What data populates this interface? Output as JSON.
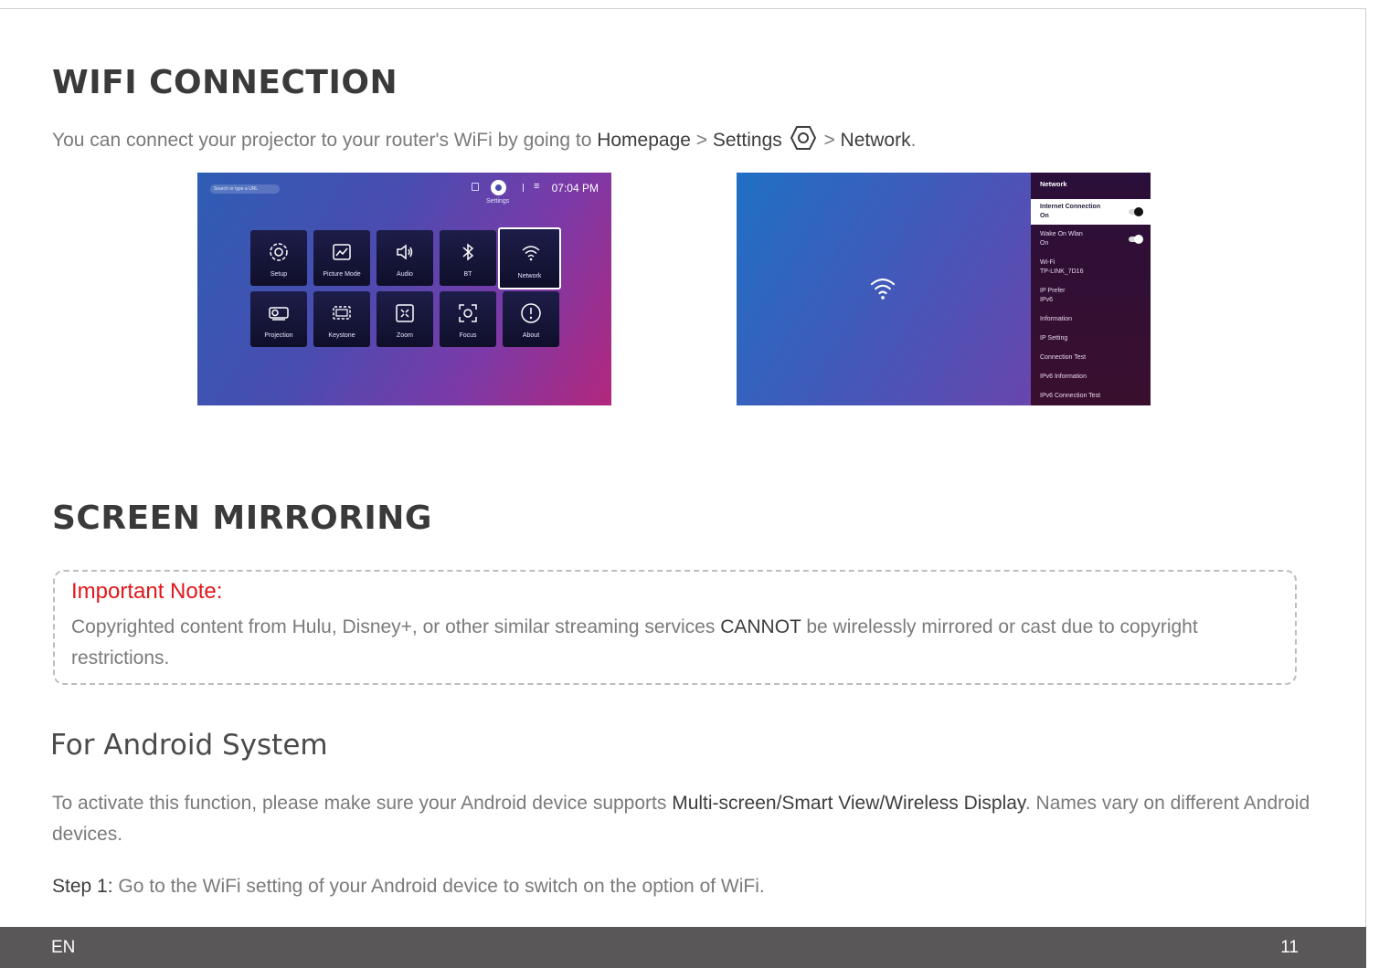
{
  "wifi": {
    "heading": "WIFI CONNECTION",
    "intro_prefix": "You can connect your projector to your router's WiFi by going to ",
    "path_homepage": "Homepage",
    "sep1": " > ",
    "path_settings": "Settings",
    "sep2": " > ",
    "path_network": "Network",
    "intro_suffix": "."
  },
  "shot1": {
    "search_placeholder": "Search or type a URL",
    "settings_label": "Settings",
    "time": "07:04 PM",
    "tiles": [
      "Setup",
      "Picture Mode",
      "Audio",
      "BT",
      "Network",
      "Projection",
      "Keystone",
      "Zoom",
      "Focus",
      "About"
    ]
  },
  "shot2": {
    "panel_title": "Network",
    "items": [
      {
        "label": "Internet Connection",
        "value": "On"
      },
      {
        "label": "Wake On Wlan",
        "value": "On"
      },
      {
        "label": "Wi-Fi",
        "value": "TP-LINK_7D16"
      },
      {
        "label": "IP Prefer",
        "value": "IPv6"
      },
      {
        "label": "Information"
      },
      {
        "label": "IP Setting"
      },
      {
        "label": "Connection Test"
      },
      {
        "label": "IPv6 Information"
      },
      {
        "label": "IPv6 Connection Test"
      }
    ]
  },
  "mirroring": {
    "heading": "SCREEN MIRRORING",
    "note_title": "Important Note:",
    "note_prefix": "Copyrighted content from Hulu, Disney+, or other similar streaming services ",
    "note_bold": "CANNOT",
    "note_suffix": " be wirelessly mirrored or cast due to copyright restrictions."
  },
  "android": {
    "heading": "For Android System",
    "para_prefix": "To activate this function, please make sure your Android device supports ",
    "para_bold": "Multi-screen/Smart View/Wireless Display",
    "para_suffix": ". Names vary on different Android devices.",
    "step1_label": "Step 1:",
    "step1_text": " Go to the WiFi setting of your Android device to switch on the option of WiFi."
  },
  "footer": {
    "lang": "EN",
    "page": "11"
  }
}
